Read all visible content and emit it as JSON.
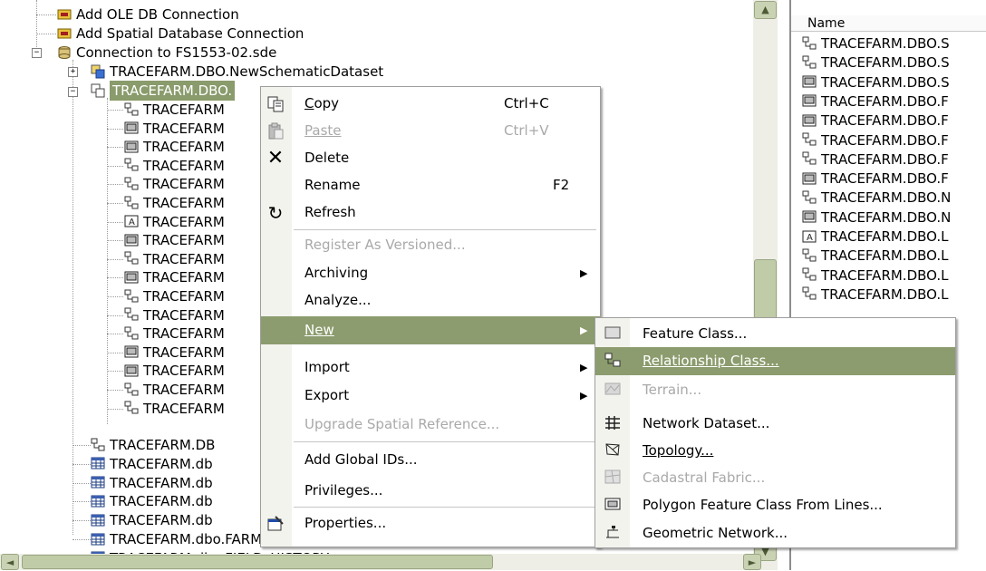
{
  "tree": {
    "top_items": [
      {
        "label": "Add OLE DB Connection",
        "icon": "connect-wizard-icon"
      },
      {
        "label": "Add Spatial Database Connection",
        "icon": "connect-wizard-icon"
      },
      {
        "label": "Connection to FS1553-02.sde",
        "icon": "database-connection-icon"
      }
    ],
    "schematic": "TRACEFARM.DBO.NewSchematicDataset",
    "selected_dataset": "TRACEFARM.DBO.",
    "children": [
      {
        "label": "TRACEFARM",
        "icon": "relationship-class-icon"
      },
      {
        "label": "TRACEFARM",
        "icon": "polygon-feature-class-icon"
      },
      {
        "label": "TRACEFARM",
        "icon": "polygon-feature-class-icon"
      },
      {
        "label": "TRACEFARM",
        "icon": "relationship-class-icon"
      },
      {
        "label": "TRACEFARM",
        "icon": "relationship-class-icon"
      },
      {
        "label": "TRACEFARM",
        "icon": "relationship-class-icon"
      },
      {
        "label": "TRACEFARM",
        "icon": "annotation-class-icon"
      },
      {
        "label": "TRACEFARM",
        "icon": "polygon-feature-class-icon"
      },
      {
        "label": "TRACEFARM",
        "icon": "relationship-class-icon"
      },
      {
        "label": "TRACEFARM",
        "icon": "polygon-feature-class-icon"
      },
      {
        "label": "TRACEFARM",
        "icon": "relationship-class-icon"
      },
      {
        "label": "TRACEFARM",
        "icon": "relationship-class-icon"
      },
      {
        "label": "TRACEFARM",
        "icon": "relationship-class-icon"
      },
      {
        "label": "TRACEFARM",
        "icon": "polygon-feature-class-icon"
      },
      {
        "label": "TRACEFARM",
        "icon": "polygon-feature-class-icon"
      },
      {
        "label": "TRACEFARM",
        "icon": "relationship-class-icon"
      },
      {
        "label": "TRACEFARM",
        "icon": "relationship-class-icon"
      }
    ],
    "after_items": [
      {
        "label": "TRACEFARM.DB",
        "icon": "relationship-class-icon"
      },
      {
        "label": "TRACEFARM.db",
        "icon": "table-icon"
      },
      {
        "label": "TRACEFARM.db",
        "icon": "table-icon"
      },
      {
        "label": "TRACEFARM.db",
        "icon": "table-icon"
      },
      {
        "label": "TRACEFARM.db",
        "icon": "table-icon"
      },
      {
        "label": "TRACEFARM.dbo.FARMMACHINERY",
        "icon": "table-icon"
      },
      {
        "label": "TRACEFARM.dbo.FIELD_HISTORY",
        "icon": "table-icon"
      }
    ]
  },
  "right_pane": {
    "column_header": "Name",
    "items": [
      {
        "label": "TRACEFARM.DBO.S",
        "icon": "relationship-class-icon"
      },
      {
        "label": "TRACEFARM.DBO.S",
        "icon": "relationship-class-icon"
      },
      {
        "label": "TRACEFARM.DBO.S",
        "icon": "polygon-feature-class-icon"
      },
      {
        "label": "TRACEFARM.DBO.F",
        "icon": "polygon-feature-class-icon"
      },
      {
        "label": "TRACEFARM.DBO.F",
        "icon": "polygon-feature-class-icon"
      },
      {
        "label": "TRACEFARM.DBO.F",
        "icon": "relationship-class-icon"
      },
      {
        "label": "TRACEFARM.DBO.F",
        "icon": "relationship-class-icon"
      },
      {
        "label": "TRACEFARM.DBO.F",
        "icon": "polygon-feature-class-icon"
      },
      {
        "label": "TRACEFARM.DBO.N",
        "icon": "relationship-class-icon"
      },
      {
        "label": "TRACEFARM.DBO.N",
        "icon": "polygon-feature-class-icon"
      },
      {
        "label": "TRACEFARM.DBO.L",
        "icon": "annotation-class-icon"
      },
      {
        "label": "TRACEFARM.DBO.L",
        "icon": "relationship-class-icon"
      },
      {
        "label": "TRACEFARM.DBO.L",
        "icon": "relationship-class-icon"
      },
      {
        "label": "TRACEFARM.DBO.L",
        "icon": "relationship-class-icon"
      }
    ]
  },
  "context_menu": {
    "copy": {
      "label": "Copy",
      "shortcut": "Ctrl+C",
      "icon": "copy-icon"
    },
    "paste": {
      "label": "Paste",
      "shortcut": "Ctrl+V",
      "icon": "paste-icon"
    },
    "delete": {
      "label": "Delete",
      "icon": "delete-icon"
    },
    "rename": {
      "label": "Rename",
      "shortcut": "F2"
    },
    "refresh": {
      "label": "Refresh",
      "icon": "refresh-icon"
    },
    "register": {
      "label": "Register As Versioned..."
    },
    "archiving": {
      "label": "Archiving"
    },
    "analyze": {
      "label": "Analyze..."
    },
    "new": {
      "label": "New"
    },
    "import": {
      "label": "Import"
    },
    "export": {
      "label": "Export"
    },
    "upgrade": {
      "label": "Upgrade Spatial Reference..."
    },
    "global_ids": {
      "label": "Add Global IDs..."
    },
    "privileges": {
      "label": "Privileges..."
    },
    "properties": {
      "label": "Properties...",
      "icon": "properties-icon"
    }
  },
  "submenu": {
    "feature_class": {
      "label": "Feature Class...",
      "icon": "feature-class-icon"
    },
    "relationship_class": {
      "label": "Relationship Class...",
      "icon": "relationship-class-icon"
    },
    "terrain": {
      "label": "Terrain...",
      "icon": "terrain-icon"
    },
    "network_dataset": {
      "label": "Network Dataset...",
      "icon": "network-dataset-icon"
    },
    "topology": {
      "label": "Topology...",
      "icon": "topology-icon"
    },
    "cadastral": {
      "label": "Cadastral Fabric...",
      "icon": "cadastral-fabric-icon"
    },
    "polygon_from_lines": {
      "label": "Polygon Feature Class From Lines...",
      "icon": "polygon-feature-class-icon"
    },
    "geometric_network": {
      "label": "Geometric Network...",
      "icon": "geometric-network-icon"
    }
  },
  "colors": {
    "highlight": "#8c9c6e",
    "scrollbar": "#c9d3b3"
  }
}
